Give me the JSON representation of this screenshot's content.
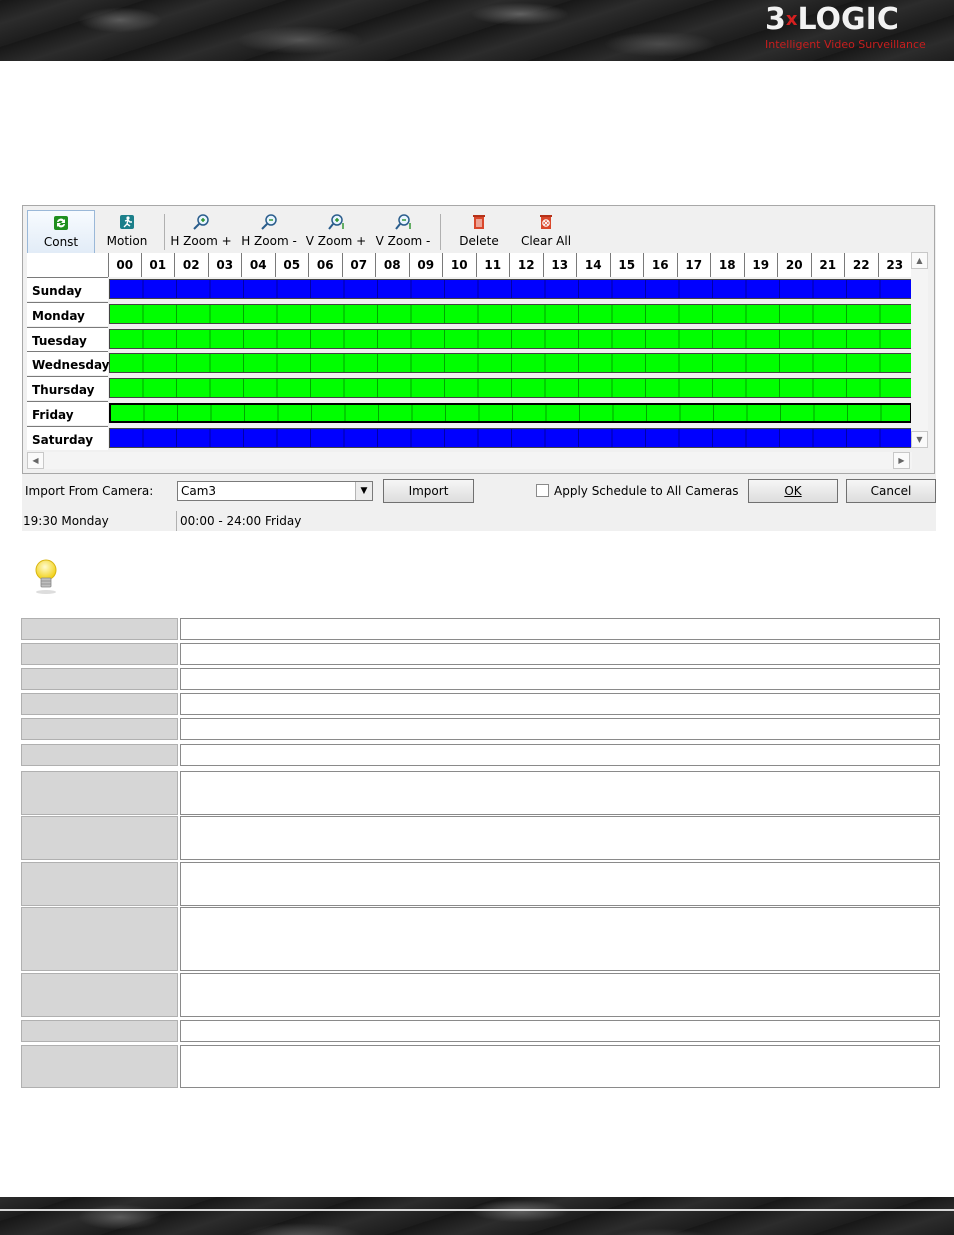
{
  "brand": {
    "name_a": "3",
    "name_x": "x",
    "name_b": "LOGIC",
    "tagline": "Intelligent Video Surveillance"
  },
  "toolbar": [
    {
      "label": "Const",
      "icon": "refresh-icon"
    },
    {
      "label": "Motion",
      "icon": "running-man-icon"
    },
    {
      "label": "H Zoom +",
      "icon": "zoom-in-horizontal-icon"
    },
    {
      "label": "H Zoom -",
      "icon": "zoom-out-horizontal-icon"
    },
    {
      "label": "V Zoom +",
      "icon": "zoom-in-vertical-icon"
    },
    {
      "label": "V Zoom -",
      "icon": "zoom-out-vertical-icon"
    },
    {
      "label": "Delete",
      "icon": "trash-icon"
    },
    {
      "label": "Clear All",
      "icon": "clear-all-icon"
    }
  ],
  "hours": [
    "00",
    "01",
    "02",
    "03",
    "04",
    "05",
    "06",
    "07",
    "08",
    "09",
    "10",
    "11",
    "12",
    "13",
    "14",
    "15",
    "16",
    "17",
    "18",
    "19",
    "20",
    "21",
    "22",
    "23"
  ],
  "days": [
    {
      "name": "Sunday",
      "mode": "Const",
      "color": "#0000ff"
    },
    {
      "name": "Monday",
      "mode": "Motion",
      "color": "#00ff00"
    },
    {
      "name": "Tuesday",
      "mode": "Motion",
      "color": "#00ff00"
    },
    {
      "name": "Wednesday",
      "mode": "Motion",
      "color": "#00ff00"
    },
    {
      "name": "Thursday",
      "mode": "Motion",
      "color": "#00ff00"
    },
    {
      "name": "Friday",
      "mode": "Motion",
      "color": "#00ff00",
      "selected": true
    },
    {
      "name": "Saturday",
      "mode": "Const",
      "color": "#0000ff"
    }
  ],
  "import": {
    "label": "Import From Camera:",
    "camera": "Cam3",
    "button": "Import"
  },
  "apply_all": {
    "label": "Apply Schedule to All Cameras",
    "checked": false
  },
  "ok_label": "OK",
  "cancel_label": "Cancel",
  "status": {
    "cursor": "19:30  Monday",
    "selection": "00:00 - 24:00  Friday"
  },
  "colors": {
    "const": "#0000ff",
    "motion": "#00ff00"
  }
}
